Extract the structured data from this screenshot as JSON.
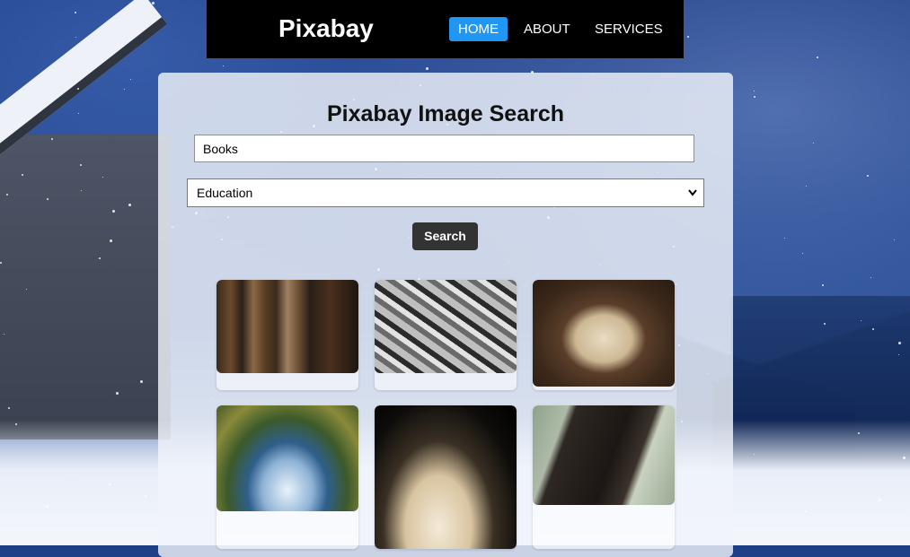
{
  "navbar": {
    "brand": "Pixabay",
    "items": [
      {
        "label": "HOME",
        "active": true
      },
      {
        "label": "ABOUT",
        "active": false
      },
      {
        "label": "SERVICES",
        "active": false
      }
    ]
  },
  "main": {
    "title": "Pixabay Image Search",
    "search_value": "Books",
    "category_selected": "Education",
    "search_button": "Search"
  },
  "results": [
    {
      "subject": "books-on-shelf"
    },
    {
      "subject": "book-pages-fan"
    },
    {
      "subject": "open-book-with-glasses"
    },
    {
      "subject": "open-book-blue"
    },
    {
      "subject": "book-pages-curled"
    },
    {
      "subject": "old-closed-book"
    }
  ],
  "colors": {
    "nav_bg": "#000000",
    "active_tab": "#2196f3",
    "button_bg": "#333333"
  }
}
